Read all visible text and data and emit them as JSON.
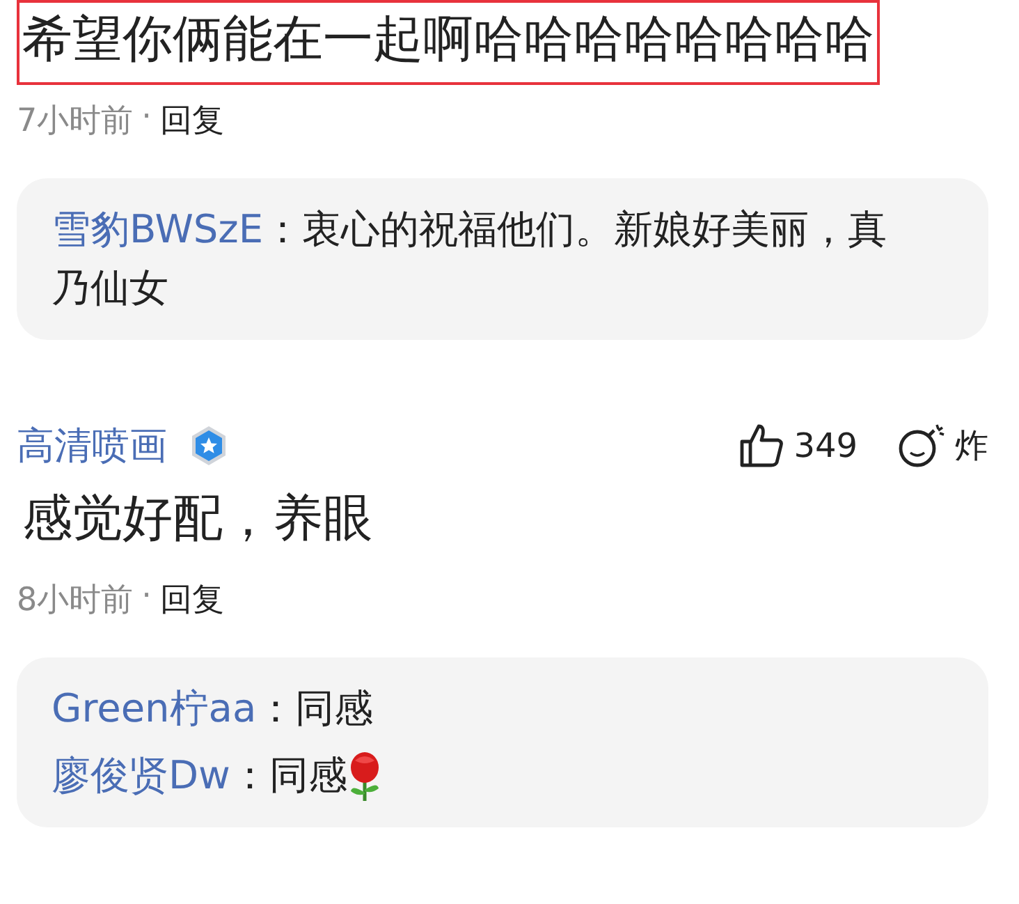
{
  "comments": [
    {
      "text": "希望你俩能在一起啊哈哈哈哈哈哈哈哈",
      "highlighted": true,
      "time": "7小时前",
      "separator": "·",
      "reply_label": "回复",
      "replies": [
        {
          "kind": "plain",
          "user": "雪豹BWSzE",
          "text": "：衷心的祝福他们。新娘好美丽，真乃仙女"
        }
      ]
    },
    {
      "user": "高清喷画",
      "verified": true,
      "likes": "349",
      "bomb": "炸",
      "text": "感觉好配，养眼",
      "highlighted": false,
      "time": "8小时前",
      "separator": "·",
      "reply_label": "回复",
      "replies": [
        {
          "kind": "plain",
          "user": "Green柠aa",
          "text": "：同感"
        },
        {
          "kind": "rose",
          "user": "廖俊贤Dw",
          "text": "：同感"
        }
      ]
    }
  ]
}
